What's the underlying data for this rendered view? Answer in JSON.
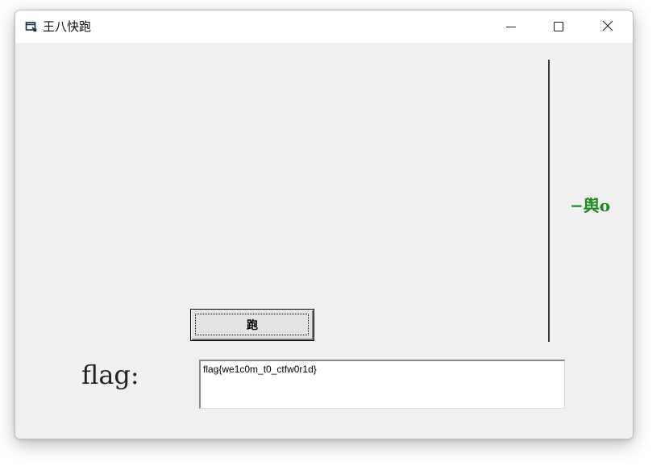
{
  "window": {
    "title": "王八快跑",
    "icon": "app-window-icon",
    "controls": {
      "minimize_icon": "minimize-icon",
      "maximize_icon": "maximize-icon",
      "close_icon": "close-icon"
    }
  },
  "canvas": {
    "turtle_label": "−舆o",
    "turtle_color": "#1f8a1f"
  },
  "run_button": {
    "label": "跑"
  },
  "flag": {
    "label": "flag:",
    "value": "flag{we1c0m_t0_ctfw0r1d}"
  }
}
